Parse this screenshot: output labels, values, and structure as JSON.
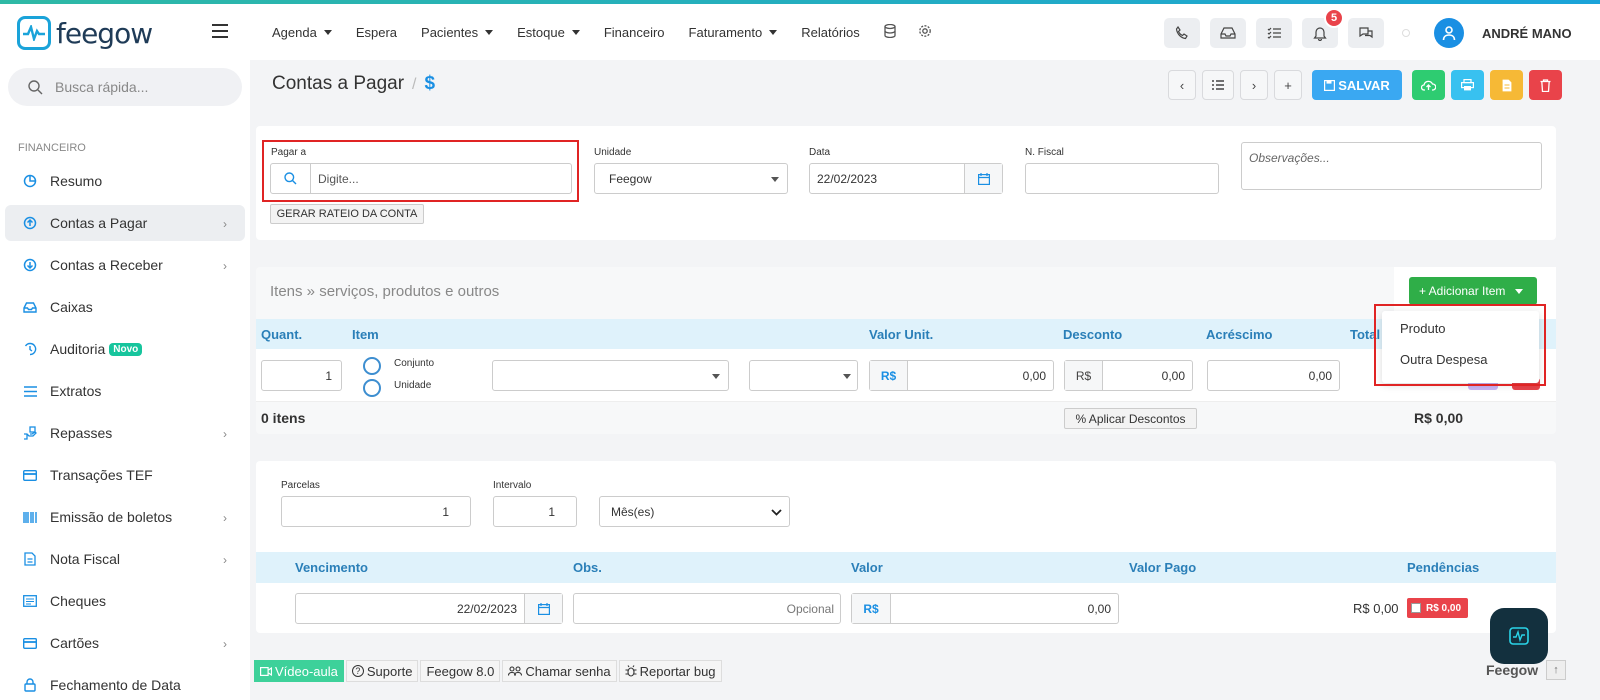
{
  "brand": {
    "name": "feegow"
  },
  "nav": {
    "items": [
      {
        "label": "Agenda",
        "caret": true
      },
      {
        "label": "Espera",
        "caret": false
      },
      {
        "label": "Pacientes",
        "caret": true
      },
      {
        "label": "Estoque",
        "caret": true
      },
      {
        "label": "Financeiro",
        "caret": false
      },
      {
        "label": "Faturamento",
        "caret": true
      },
      {
        "label": "Relatórios",
        "caret": false
      }
    ],
    "notifications": "5",
    "user": "ANDRÉ MANO"
  },
  "sidebar": {
    "search_placeholder": "Busca rápida...",
    "section": "FINANCEIRO",
    "items": [
      {
        "label": "Resumo",
        "icon": "pie-chart-icon"
      },
      {
        "label": "Contas a Pagar",
        "icon": "arrow-up-circle-icon",
        "active": true
      },
      {
        "label": "Contas a Receber",
        "icon": "arrow-down-circle-icon"
      },
      {
        "label": "Caixas",
        "icon": "inbox-icon"
      },
      {
        "label": "Auditoria",
        "icon": "history-icon",
        "badge": "Novo"
      },
      {
        "label": "Extratos",
        "icon": "list-icon"
      },
      {
        "label": "Repasses",
        "icon": "transfer-icon"
      },
      {
        "label": "Transações TEF",
        "icon": "card-icon"
      },
      {
        "label": "Emissão de boletos",
        "icon": "barcode-icon"
      },
      {
        "label": "Nota Fiscal",
        "icon": "document-icon"
      },
      {
        "label": "Cheques",
        "icon": "check-doc-icon"
      },
      {
        "label": "Cartões",
        "icon": "credit-card-icon"
      },
      {
        "label": "Fechamento de Data",
        "icon": "lock-icon"
      }
    ]
  },
  "page": {
    "title": "Contas a Pagar",
    "sep": "/",
    "symbol": "$",
    "save_label": "SALVAR"
  },
  "form": {
    "pagar_a_label": "Pagar a",
    "pagar_a_placeholder": "Digite...",
    "unidade_label": "Unidade",
    "unidade_value": "Feegow",
    "data_label": "Data",
    "data_value": "22/02/2023",
    "nfiscal_label": "N. Fiscal",
    "obs_placeholder": "Observações...",
    "rateio_button": "GERAR RATEIO DA CONTA"
  },
  "items": {
    "title": "Itens » serviços, produtos e outros",
    "add_button": "+ Adicionar Item",
    "columns": {
      "quant": "Quant.",
      "item": "Item",
      "valor": "Valor Unit.",
      "desconto": "Desconto",
      "acrescimo": "Acréscimo",
      "total": "Total"
    },
    "row": {
      "quant": "1",
      "conjunto": "Conjunto",
      "unidade": "Unidade",
      "currency": "R$",
      "valor": "0,00",
      "desconto": "0,00",
      "acrescimo": "0,00"
    },
    "count": "0 itens",
    "aplicar": "% Aplicar Descontos",
    "total": "R$ 0,00",
    "dropdown": [
      "Produto",
      "Outra Despesa"
    ]
  },
  "parcelas": {
    "parcelas_label": "Parcelas",
    "parcelas_value": "1",
    "intervalo_label": "Intervalo",
    "intervalo_value": "1",
    "periodo": "Mês(es)",
    "columns": {
      "venc": "Vencimento",
      "obs": "Obs.",
      "valor": "Valor",
      "pago": "Valor Pago",
      "pend": "Pendências"
    },
    "row": {
      "venc": "22/02/2023",
      "obs_placeholder": "Opcional",
      "currency": "R$",
      "valor": "0,00",
      "pago": "R$ 0,00",
      "pend": "R$ 0,00"
    }
  },
  "footer": {
    "video": "Vídeo-aula",
    "suporte": "Suporte",
    "versao": "Feegow 8.0",
    "senha": "Chamar senha",
    "bug": "Reportar bug",
    "brand": "Feegow"
  }
}
